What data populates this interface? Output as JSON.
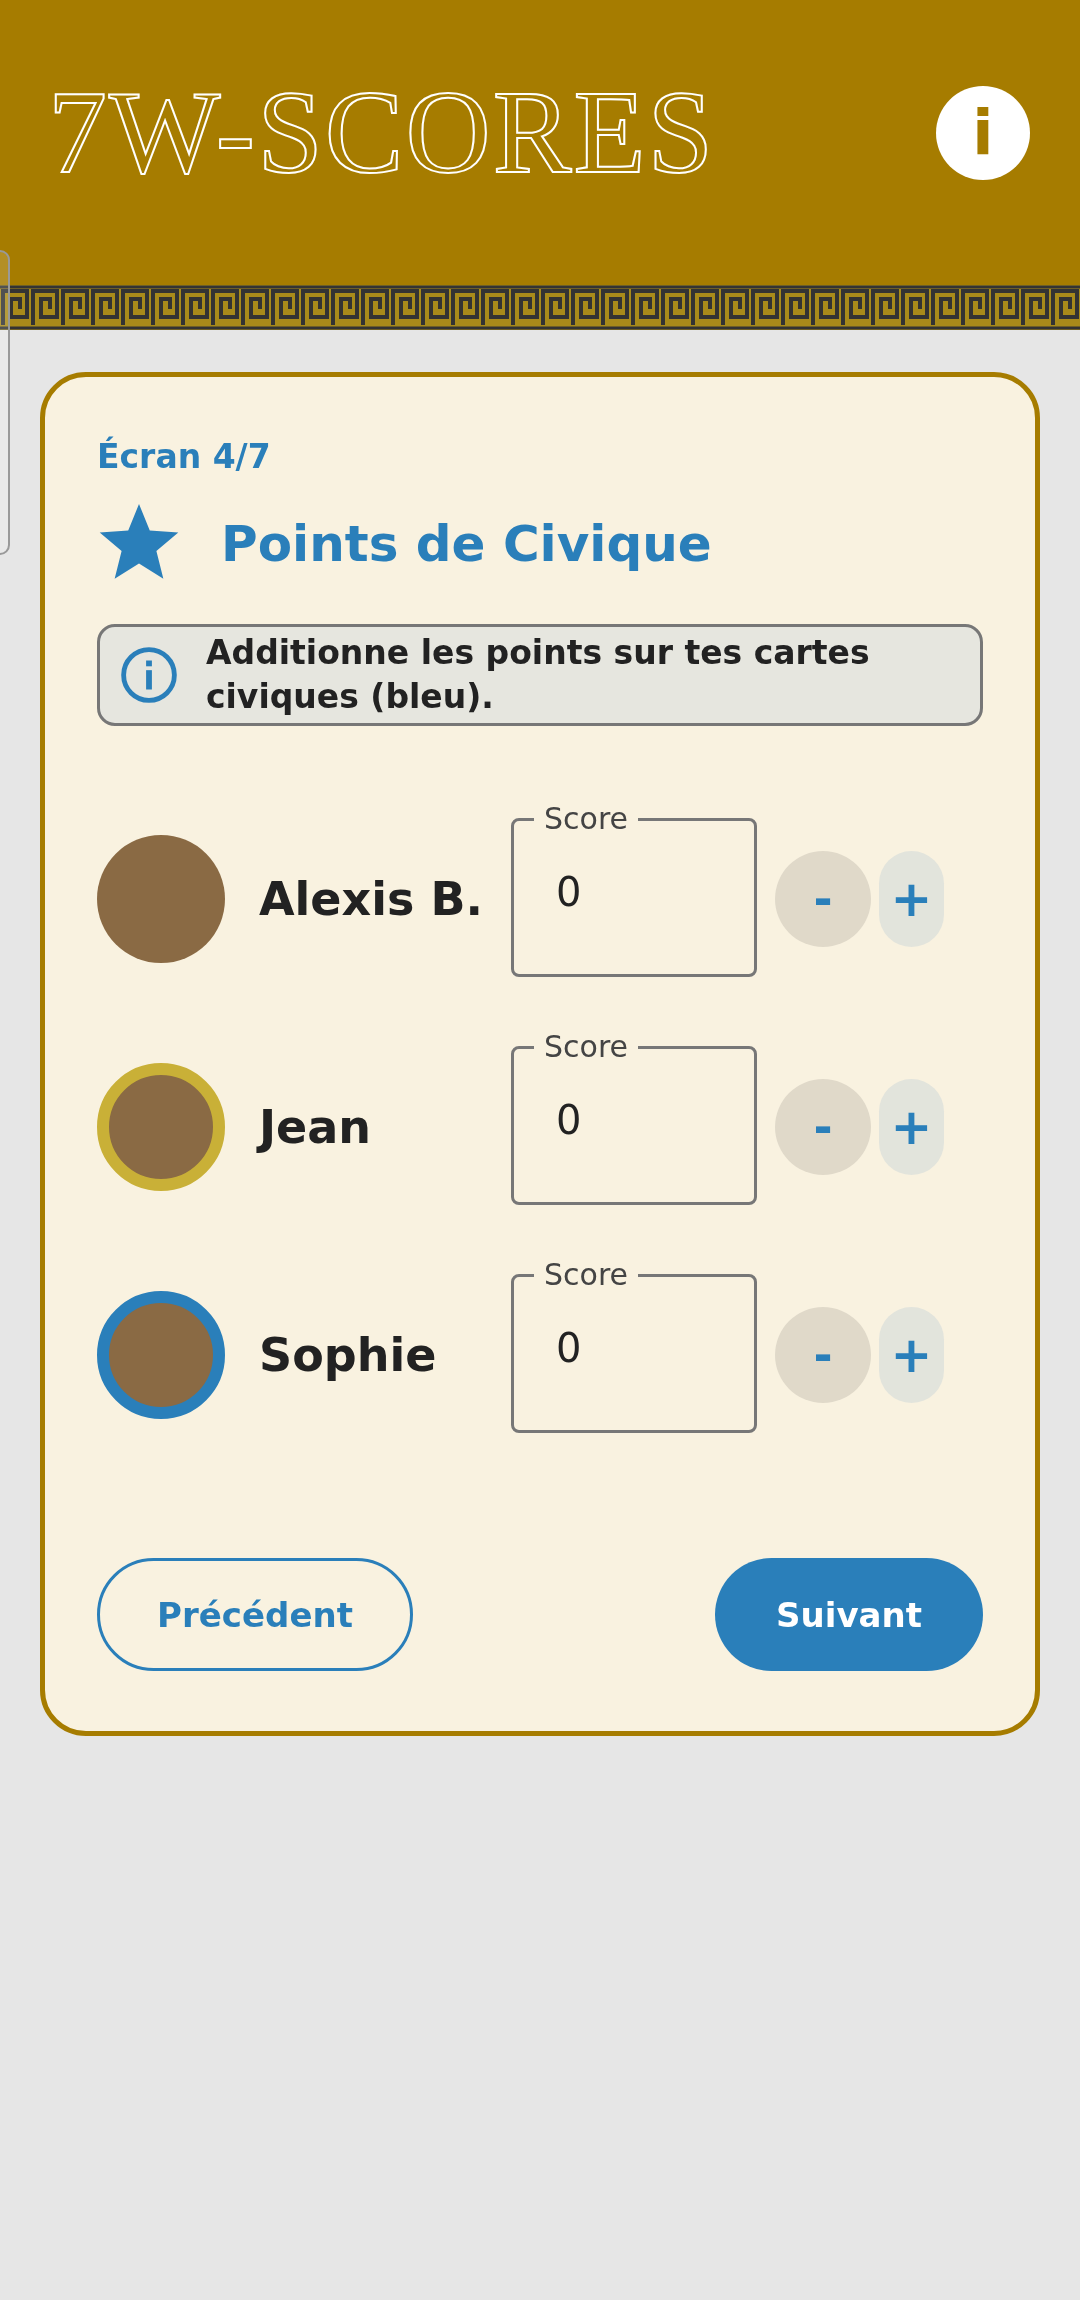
{
  "header": {
    "logo": "7W-SCORES",
    "info_button": "i"
  },
  "card": {
    "step": "Écran 4/7",
    "title": "Points de Civique",
    "hint": "Additionne les points sur tes cartes civiques (bleu).",
    "players": [
      {
        "name": "Alexis B.",
        "score_label": "Score",
        "score": "0",
        "minus": "-",
        "plus": "+"
      },
      {
        "name": "Jean",
        "color": "#c9b037",
        "score_label": "Score",
        "score": "0",
        "minus": "-",
        "plus": "+"
      },
      {
        "name": "Sophie",
        "color": "#2a7fba",
        "score_label": "Score",
        "score": "0",
        "minus": "-",
        "plus": "+"
      }
    ],
    "previous": "Précédent",
    "next": "Suivant"
  }
}
